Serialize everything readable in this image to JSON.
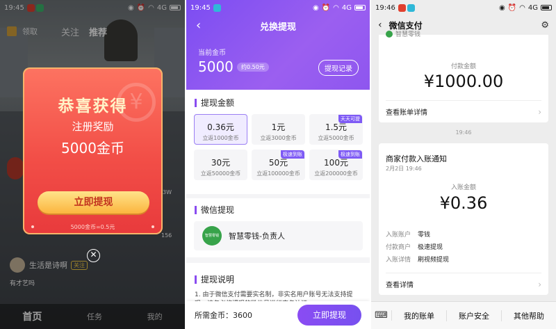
{
  "panel1": {
    "status_time": "19:45",
    "status_net": "4G",
    "top_tabs": [
      "领取",
      "关注",
      "推荐"
    ],
    "popup": {
      "title": "恭喜获得",
      "subtitle": "注册奖励",
      "amount": "5000金币",
      "button": "立即提现",
      "rate": "5000金币=0.5元"
    },
    "side_count_1": "3W",
    "side_count_2": "156",
    "user_name": "生活是诗啊",
    "follow_label": "关注",
    "caption": "有才艺吗",
    "nav": [
      "首页",
      "任务",
      "我的"
    ]
  },
  "panel2": {
    "status_time": "19:45",
    "status_net": "4G",
    "back_icon": "‹",
    "title": "兑换提现",
    "coin_label": "当前金币",
    "coin_value": "5000",
    "coin_approx": "约0.50元",
    "record_button": "提现记录",
    "amount_section": "提现金额",
    "amounts": [
      {
        "value": "0.36元",
        "sub": "立返1000金币",
        "tag": "",
        "selected": true
      },
      {
        "value": "1元",
        "sub": "立返3000金币",
        "tag": "",
        "selected": false
      },
      {
        "value": "1.5元",
        "sub": "立返5000金币",
        "tag": "天天可提",
        "selected": false
      },
      {
        "value": "30元",
        "sub": "立返50000金币",
        "tag": "",
        "selected": false
      },
      {
        "value": "50元",
        "sub": "立返100000金币",
        "tag": "极速到账",
        "selected": false
      },
      {
        "value": "100元",
        "sub": "立返200000金币",
        "tag": "极速到账",
        "selected": false
      }
    ],
    "wechat_section": "微信提现",
    "wechat_logo_text": "智慧零钱",
    "wechat_account": "智慧零钱-负责人",
    "note_section": "提现说明",
    "note_text": "1. 由于微信支付需要实名制，非实名用户账号无法支持提现，请务必将提现的微信号进行实名认证；",
    "need_label": "所需金币：3600",
    "submit_button": "立即提现"
  },
  "panel3": {
    "status_time": "19:46",
    "status_net": "4G",
    "title": "微信支付",
    "merchant_top": "智慧零钱",
    "pay_label": "付款金额",
    "pay_amount": "¥1000.00",
    "bill_link": "查看账单详情",
    "timestamp": "19:46",
    "notice_title": "商家付款入账通知",
    "notice_date": "2月2日 19:46",
    "income_label": "入账金额",
    "income_amount": "¥0.36",
    "rows": [
      {
        "k": "入账账户",
        "v": "零钱"
      },
      {
        "k": "付款商户",
        "v": "极速提现"
      },
      {
        "k": "入账详情",
        "v": "刷视频提现"
      }
    ],
    "detail_link": "查看详情",
    "menu": [
      "我的账单",
      "账户安全",
      "其他帮助"
    ]
  },
  "colors": {
    "popup_red": "#f24e47",
    "popup_button": "#fbb53e",
    "purple": "#8a4cf0",
    "wechat_green": "#37a34a"
  }
}
